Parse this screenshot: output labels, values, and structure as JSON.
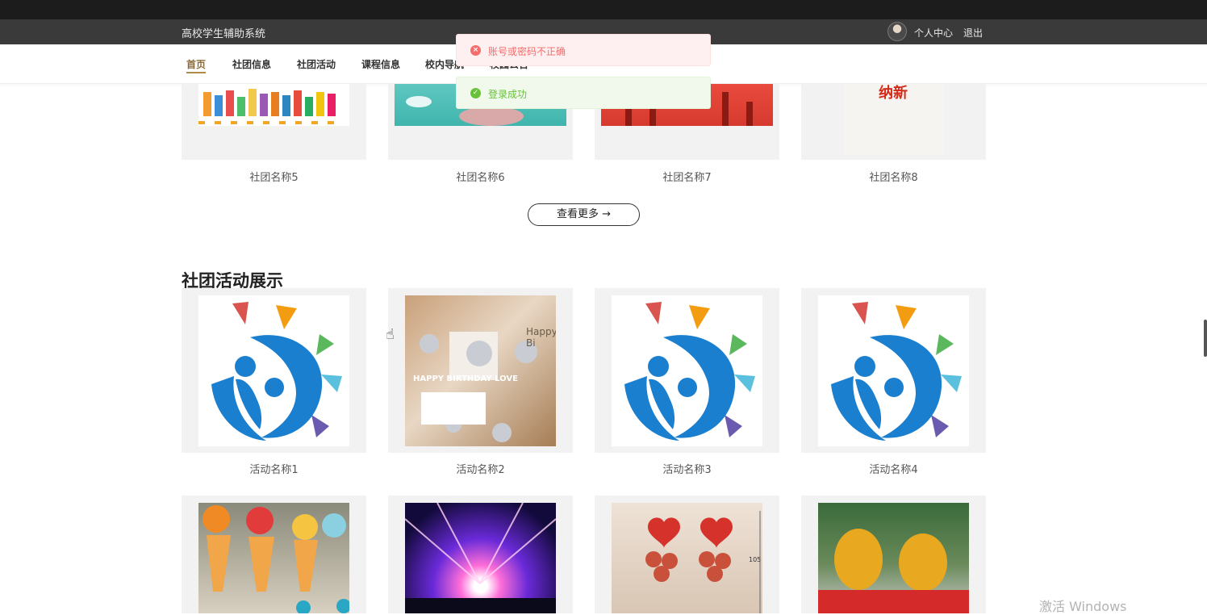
{
  "header": {
    "site_title": "高校学生辅助系统",
    "user_center": "个人中心",
    "logout": "退出"
  },
  "nav": {
    "items": [
      {
        "label": "首页",
        "active": true
      },
      {
        "label": "社团信息"
      },
      {
        "label": "社团活动"
      },
      {
        "label": "课程信息"
      },
      {
        "label": "校内导航"
      },
      {
        "label": "校园公告"
      }
    ]
  },
  "toasts": {
    "error": "账号或密码不正确",
    "success": "登录成功"
  },
  "clubs": {
    "captions": [
      "社团名称5",
      "社团名称6",
      "社团名称7",
      "社团名称8"
    ],
    "image_text_8": "纳新",
    "more_button": "查看更多 →"
  },
  "activities": {
    "section_title": "社团活动展示",
    "captions": [
      "活动名称1",
      "活动名称2",
      "活动名称3",
      "活动名称4"
    ],
    "room_text": "HAPPY BIRTHDAY LOVE",
    "room_sign": "Happy Bi",
    "balloon_size": "105"
  },
  "system": {
    "watermark": "激活 Windows"
  },
  "colors": {
    "accent": "#b08a4a",
    "topbar": "#3a3a3a",
    "error": "#f56c6c",
    "success": "#67c23a"
  }
}
